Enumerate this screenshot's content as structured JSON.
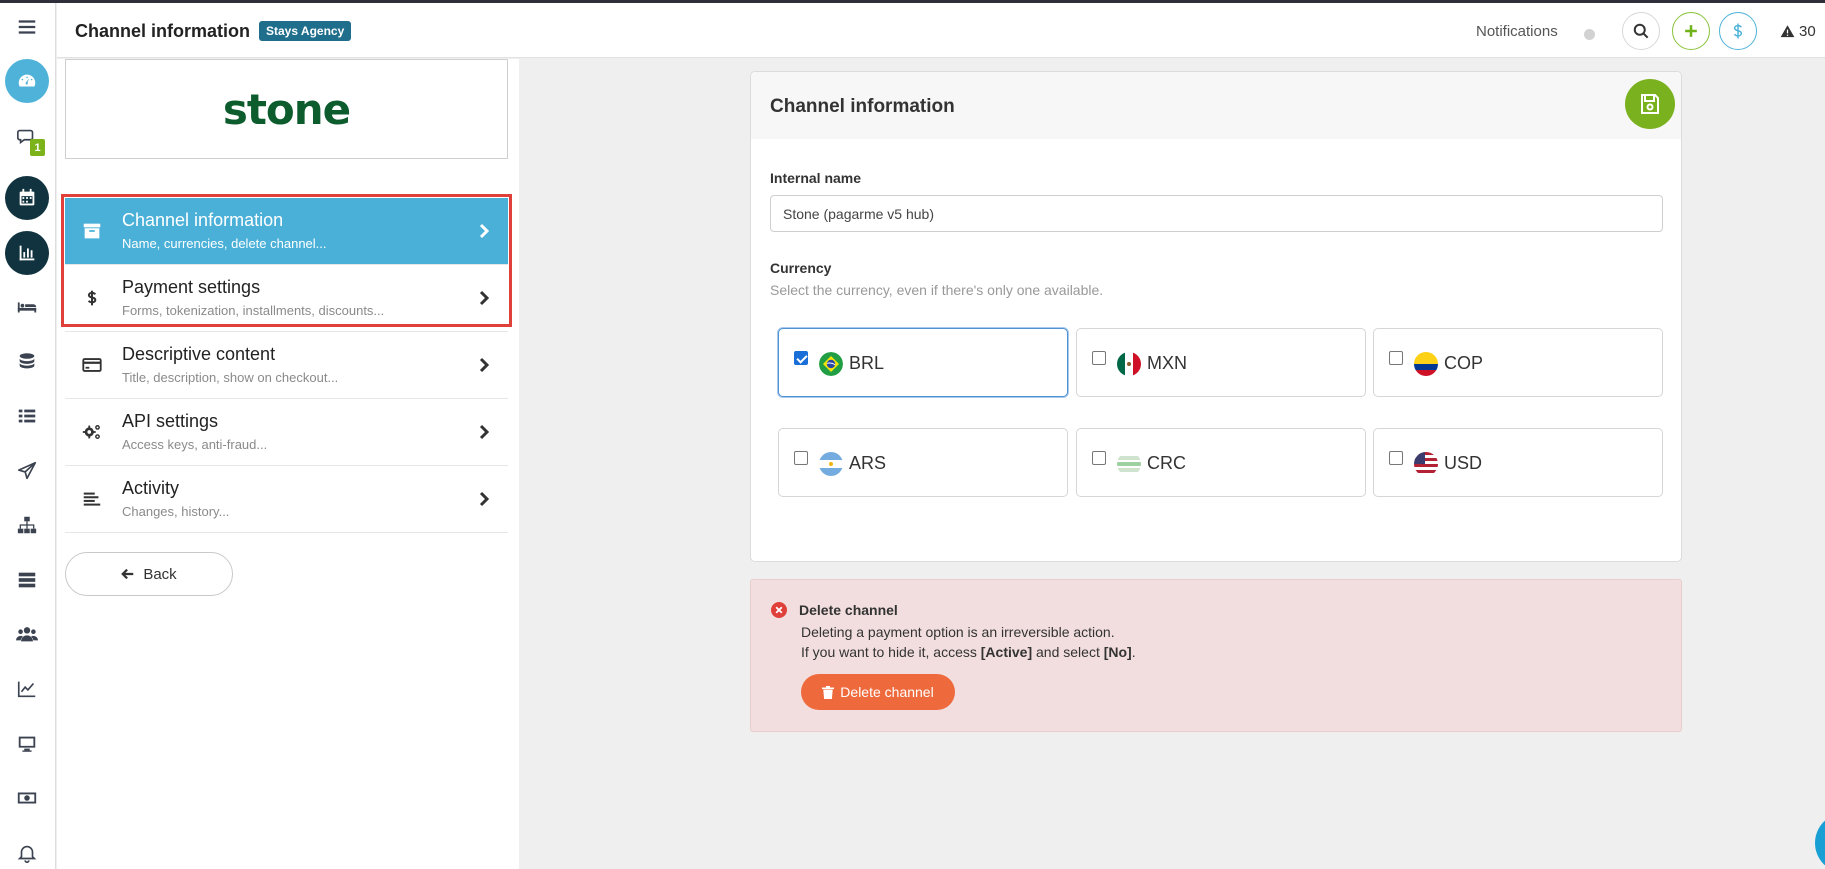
{
  "header": {
    "title": "Channel information",
    "agency_badge": "Stays Agency",
    "notifications_label": "Notifications",
    "warning_count": "30"
  },
  "sidebar_rail": {
    "reservations_badge": "1",
    "icons": [
      "menu-icon",
      "dashboard-icon",
      "chat-icon",
      "calendar-icon",
      "bar-chart-icon",
      "bed-icon",
      "database-icon",
      "list-icon",
      "send-icon",
      "sitemap-icon",
      "server-icon",
      "users-icon",
      "line-chart-icon",
      "monitor-icon",
      "money-icon",
      "bell-icon"
    ]
  },
  "brand": {
    "logo_text": "stone"
  },
  "menu": {
    "items": [
      {
        "title": "Channel information",
        "subtitle": "Name, currencies, delete channel...",
        "icon": "archive-icon",
        "active": true
      },
      {
        "title": "Payment settings",
        "subtitle": "Forms, tokenization, installments, discounts...",
        "icon": "dollar-icon",
        "active": false
      },
      {
        "title": "Descriptive content",
        "subtitle": "Title, description, show on checkout...",
        "icon": "credit-card-icon",
        "active": false
      },
      {
        "title": "API settings",
        "subtitle": "Access keys, anti-fraud...",
        "icon": "gears-icon",
        "active": false
      },
      {
        "title": "Activity",
        "subtitle": "Changes, history...",
        "icon": "align-left-icon",
        "active": false
      }
    ],
    "back_label": "Back"
  },
  "card": {
    "title": "Channel information",
    "internal_name_label": "Internal name",
    "internal_name_value": "Stone (pagarme v5 hub)",
    "currency_label": "Currency",
    "currency_hint": "Select the currency, even if there's only one available.",
    "currencies": [
      {
        "code": "BRL",
        "checked": true
      },
      {
        "code": "MXN",
        "checked": false
      },
      {
        "code": "COP",
        "checked": false
      },
      {
        "code": "ARS",
        "checked": false
      },
      {
        "code": "CRC",
        "checked": false
      },
      {
        "code": "USD",
        "checked": false
      }
    ]
  },
  "delete_alert": {
    "title": "Delete channel",
    "line1": "Deleting a payment option is an irreversible action.",
    "line2_prefix": "If you want to hide it, access ",
    "line2_active": "[Active]",
    "line2_middle": " and select ",
    "line2_no": "[No]",
    "line2_suffix": ".",
    "button_label": "Delete channel"
  },
  "colors": {
    "accent_blue": "#4ab0d8",
    "save_green": "#7ab11e",
    "delete_orange": "#ee6a3c",
    "alert_bg": "#f2dede",
    "highlight_red": "#e0403a"
  }
}
